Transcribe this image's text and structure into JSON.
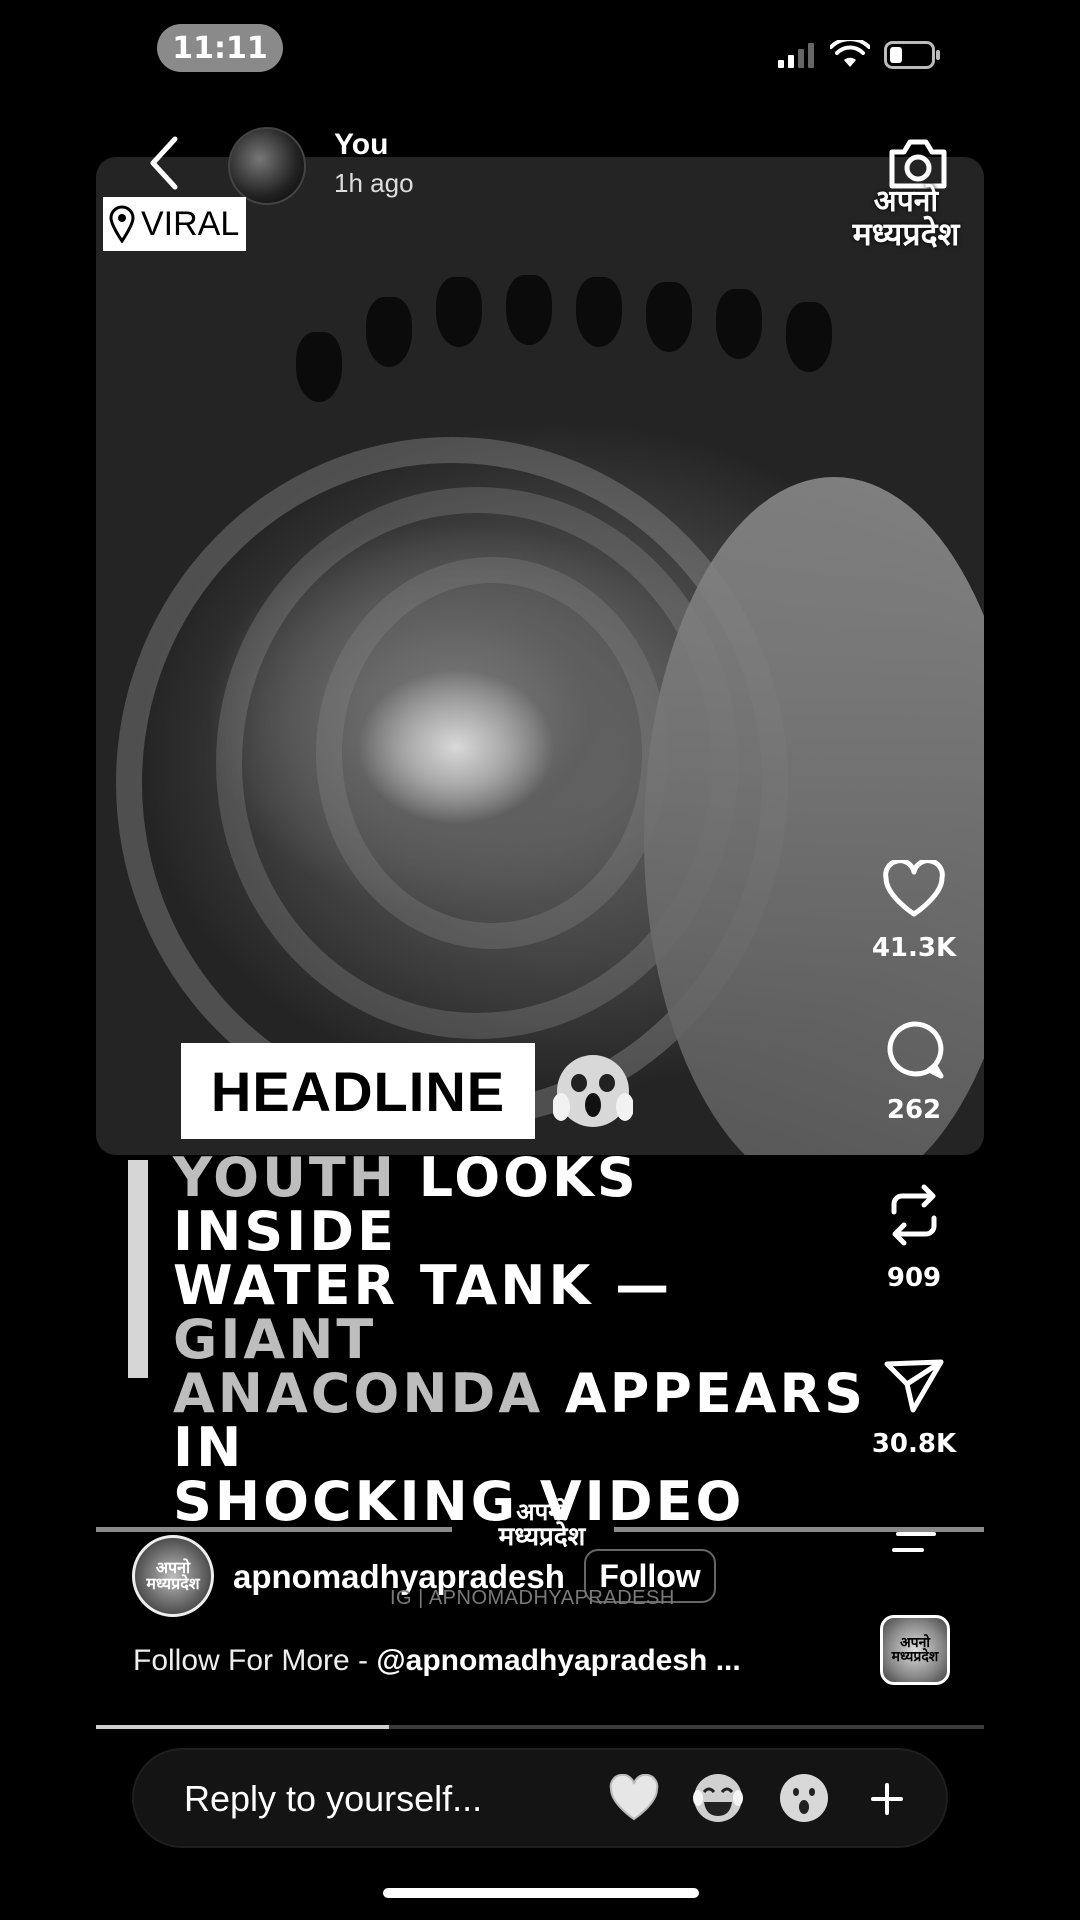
{
  "status_bar": {
    "time": "11:11"
  },
  "story_header": {
    "user": "You",
    "time_ago": "1h ago"
  },
  "location_tag": {
    "label": "VIRAL"
  },
  "brand_watermark": {
    "line1": "अपनो",
    "line2": "मध्यप्रदेश"
  },
  "post": {
    "headline_label": "HEADLINE",
    "headline_lines": [
      {
        "dim": "YOUTH",
        "bright": " LOOKS INSIDE"
      },
      {
        "dim": "",
        "bright": "WATER TANK — ",
        "dim2": "GIANT"
      },
      {
        "dim": "ANACONDA",
        "bright": " APPEARS IN"
      },
      {
        "dim": "",
        "bright": "SHOCKING VIDEO"
      }
    ]
  },
  "actions": {
    "likes": "41.3K",
    "comments": "262",
    "reposts": "909",
    "shares": "30.8K"
  },
  "account": {
    "avatar_text": "अपनो मध्यप्रदेश",
    "name": "apnomadhyapradesh",
    "follow_label": "Follow",
    "ig_watermark": "IG | APNOMADHYAPRADESH",
    "caption_prefix": "Follow For More - ",
    "caption_handle": "@apnomadhyapradesh ..."
  },
  "progress": {
    "fraction": 0.33
  },
  "reply": {
    "placeholder": "Reply to yourself..."
  },
  "quick_reactions": [
    "white-heart",
    "laughing-crying",
    "surprised"
  ],
  "colors": {
    "background": "#000000",
    "text": "#ffffff",
    "headline_dim": "#bdbdbd"
  }
}
